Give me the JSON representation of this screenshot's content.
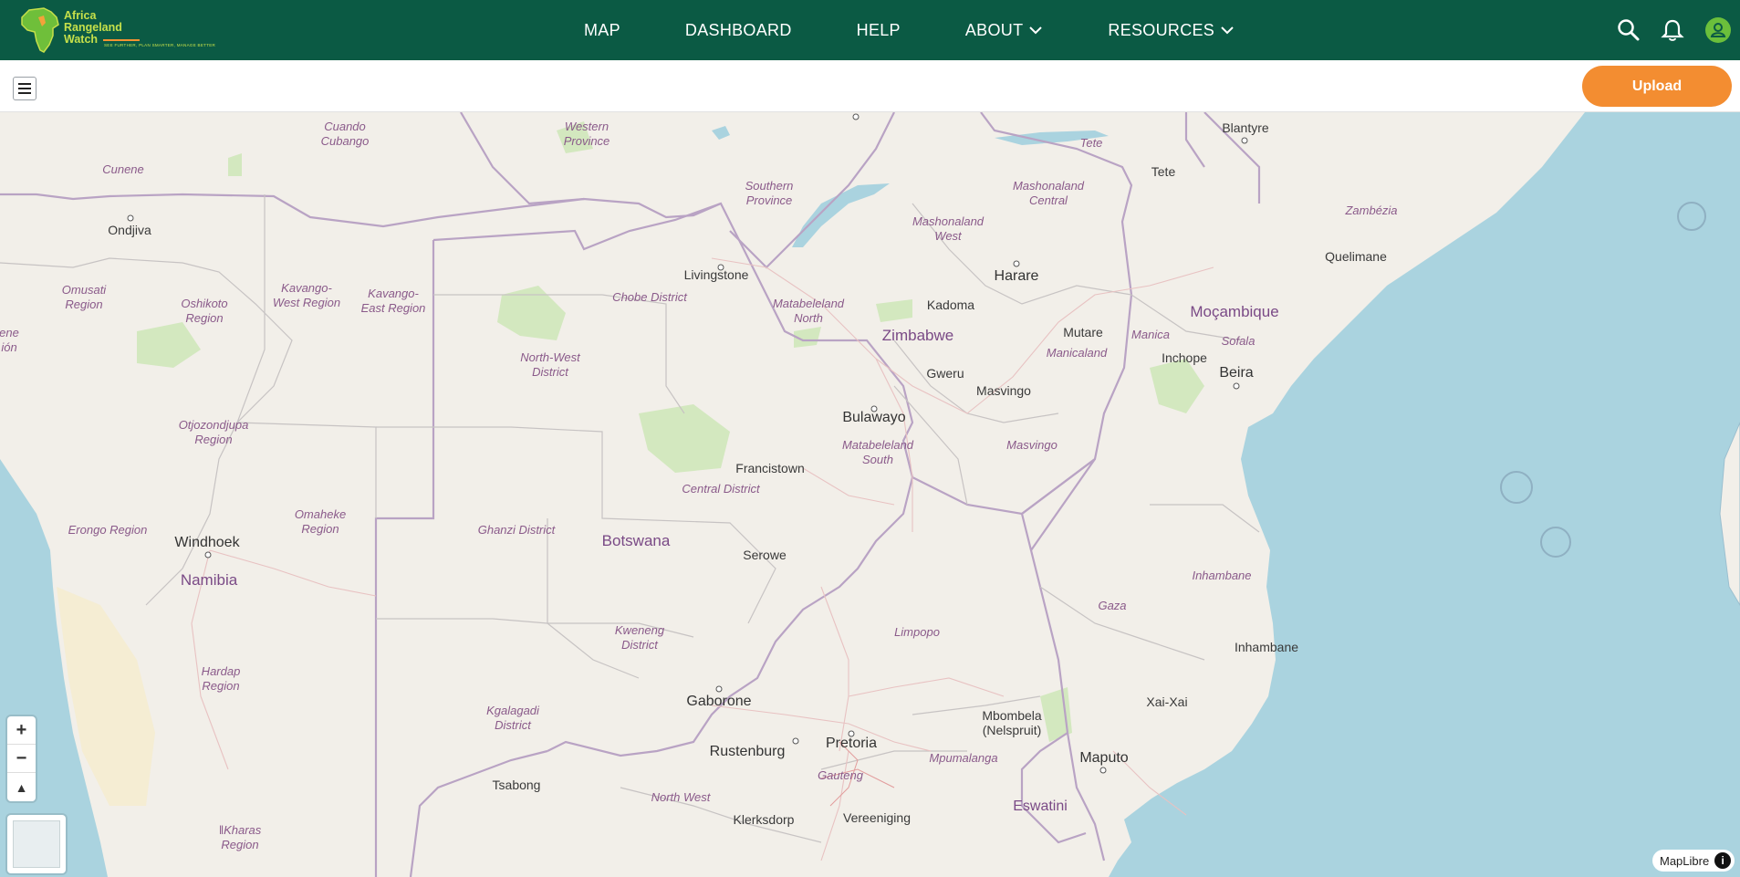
{
  "brand": {
    "line1": "Africa",
    "line2": "Rangeland",
    "line3": "Watch",
    "tagline": "SEE FURTHER, PLAN SMARTER, MANAGE BETTER"
  },
  "nav": {
    "items": [
      "MAP",
      "DASHBOARD",
      "HELP",
      "ABOUT",
      "RESOURCES"
    ]
  },
  "toolbar": {
    "upload_label": "Upload"
  },
  "map": {
    "zoom_in": "+",
    "zoom_out": "−",
    "compass": "▲",
    "attribution": "MapLibre",
    "info": "i",
    "labels": {
      "western_province": "Western\nProvince",
      "cuando_cubango": "Cuando\nCubango",
      "cunene": "Cunene",
      "southern_province": "Southern\nProvince",
      "mashonaland_central": "Mashonaland\nCentral",
      "tete_region": "Tete",
      "blantyre": "Blantyre",
      "tete": "Tete",
      "zambezia": "Zambézia",
      "ondjiva": "Ondjiva",
      "mashonaland_west": "Mashonaland\nWest",
      "quelimane": "Quelimane",
      "livingstone": "Livingstone",
      "harare": "Harare",
      "omusati": "Omusati\nRegion",
      "oshikoto": "Oshikoto\nRegion",
      "kavango_west": "Kavango-\nWest Region",
      "kavango_east": "Kavango-\nEast Region",
      "chobe": "Chobe District",
      "matabeleland_north": "Matabeleland\nNorth",
      "kadoma": "Kadoma",
      "mocambique": "Moçambique",
      "zimbabwe": "Zimbabwe",
      "mutare": "Mutare",
      "manica": "Manica",
      "sofala": "Sofala",
      "north_west": "North-West\nDistrict",
      "manicaland": "Manicaland",
      "inchope": "Inchope",
      "gweru": "Gweru",
      "beira": "Beira",
      "masvingo_city": "Masvingo",
      "bulawayo": "Bulawayo",
      "otjozondjupa": "Otjozondjupa\nRegion",
      "matabeleland_south": "Matabeleland\nSouth",
      "masvingo": "Masvingo",
      "francistown": "Francistown",
      "central_district": "Central District",
      "omaheke": "Omaheke\nRegion",
      "erongo": "Erongo Region",
      "ghanzi": "Ghanzi District",
      "windhoek": "Windhoek",
      "botswana": "Botswana",
      "serowe": "Serowe",
      "inhambane_region": "Inhambane",
      "namibia": "Namibia",
      "gaza": "Gaza",
      "kweneng": "Kweneng\nDistrict",
      "limpopo": "Limpopo",
      "inhambane": "Inhambane",
      "hardap": "Hardap\nRegion",
      "gaborone": "Gaborone",
      "xai_xai": "Xai-Xai",
      "kgalagadi": "Kgalagadi\nDistrict",
      "mbombela": "Mbombela\n(Nelspruit)",
      "pretoria": "Pretoria",
      "rustenburg": "Rustenburg",
      "mpumalanga": "Mpumalanga",
      "maputo": "Maputo",
      "gauteng": "Gauteng",
      "tsabong": "Tsabong",
      "north_west_sa": "North West",
      "eswatini": "Eswatini",
      "klerksdorp": "Klerksdorp",
      "vereeniging": "Vereeniging",
      "ilkharas": "ǁKharas\nRegion",
      "cuene_edge": "ene\nión"
    }
  },
  "colors": {
    "header": "#0b5a44",
    "upload": "#f38d31",
    "ocean": "#aad3df",
    "land": "#f2efe9",
    "accent": "#c6e04a"
  }
}
